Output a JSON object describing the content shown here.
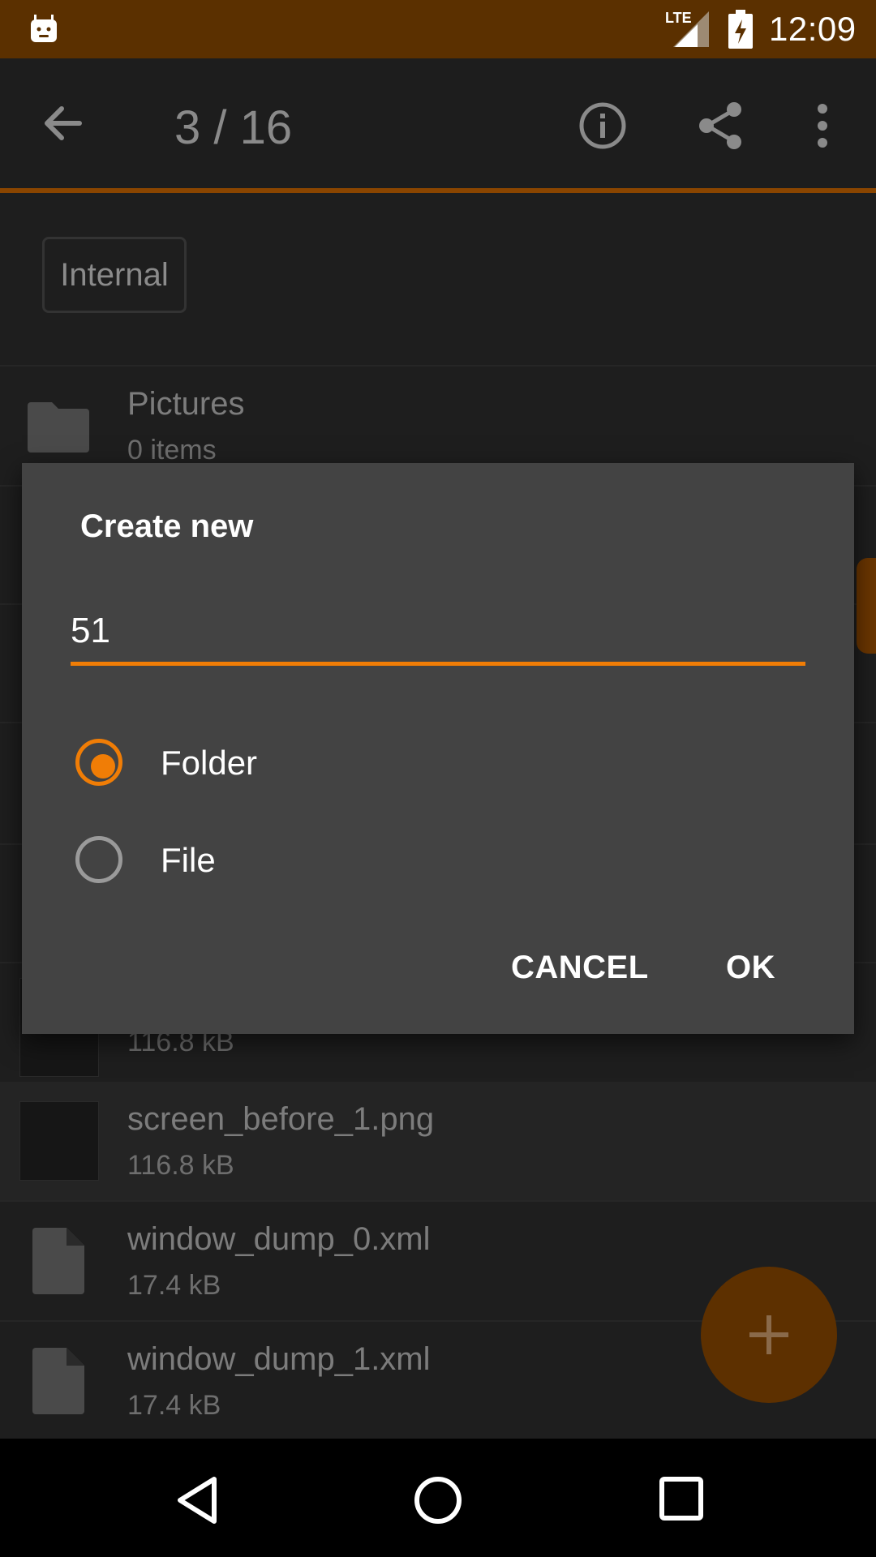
{
  "status_bar": {
    "time": "12:09",
    "network": "LTE"
  },
  "toolbar": {
    "title": "3 / 16"
  },
  "storage_chip": "Internal",
  "files": [
    {
      "name": "Pictures",
      "meta": "0 items",
      "icon": "folder-icon"
    },
    {
      "name": "",
      "meta": "116.8 kB",
      "icon": "image-thumbnail"
    },
    {
      "name": "screen_before_1.png",
      "meta": "116.8 kB",
      "icon": "image-thumbnail"
    },
    {
      "name": "window_dump_0.xml",
      "meta": "17.4 kB",
      "icon": "file-icon"
    },
    {
      "name": "window_dump_1.xml",
      "meta": "17.4 kB",
      "icon": "file-icon"
    }
  ],
  "dialog": {
    "title": "Create new",
    "input_value": "51",
    "options": [
      {
        "label": "Folder",
        "checked": true
      },
      {
        "label": "File",
        "checked": false
      }
    ],
    "cancel_label": "CANCEL",
    "ok_label": "OK"
  },
  "colors": {
    "accent": "#f07d06",
    "status_bar": "#5b3000",
    "dialog_bg": "#434343"
  }
}
